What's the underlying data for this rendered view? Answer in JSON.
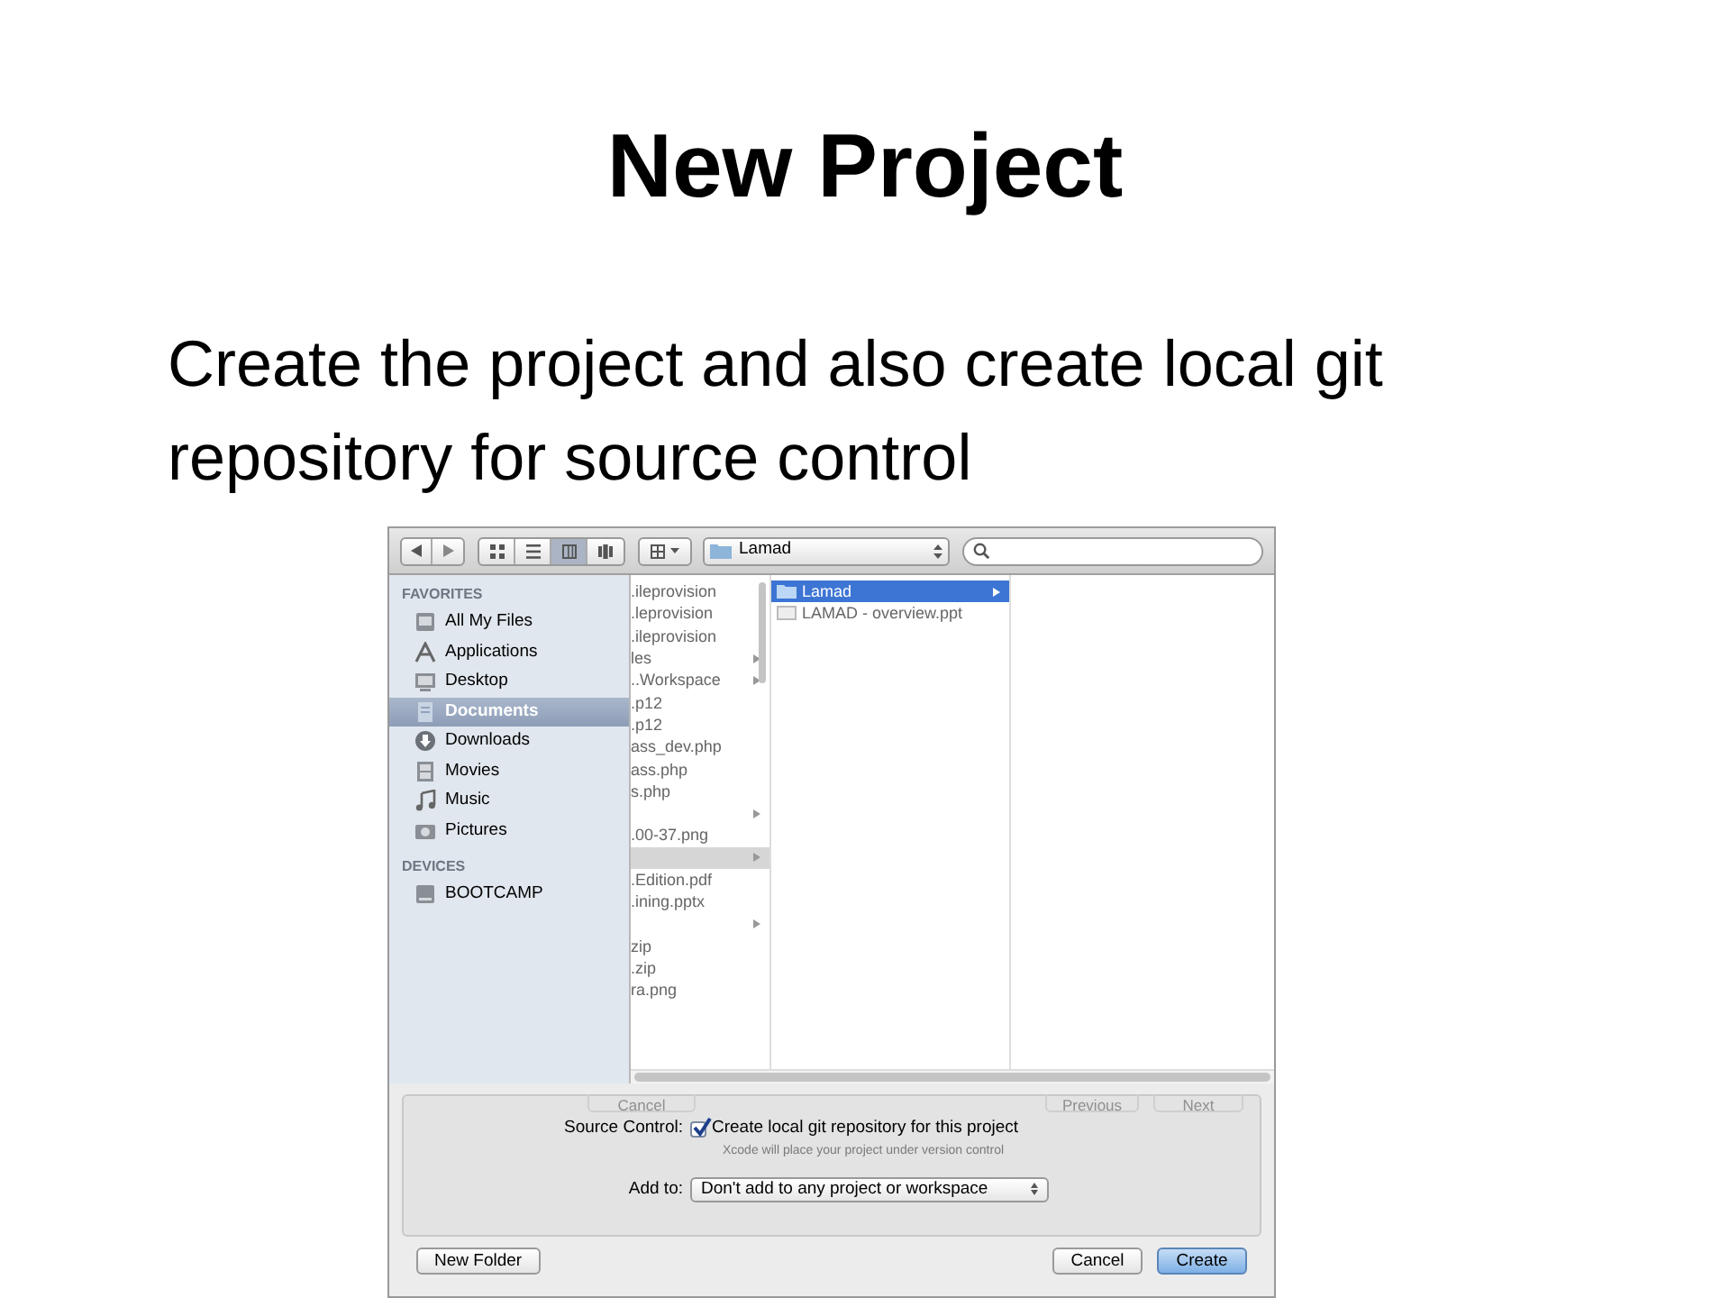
{
  "slide": {
    "title": "New Project",
    "body": "Create the project and also create local git repository for source control"
  },
  "dialog": {
    "toolbar": {
      "view_modes": [
        {
          "kind": "icons",
          "selected": false
        },
        {
          "kind": "list",
          "selected": false
        },
        {
          "kind": "columns",
          "selected": true
        },
        {
          "kind": "coverflow",
          "selected": false
        }
      ],
      "location": "Lamad"
    },
    "sidebar": [
      {
        "heading": "FAVORITES",
        "items": [
          {
            "label": "All My Files",
            "selected": false
          },
          {
            "label": "Applications",
            "selected": false
          },
          {
            "label": "Desktop",
            "selected": false
          },
          {
            "label": "Documents",
            "selected": true
          },
          {
            "label": "Downloads",
            "selected": false
          },
          {
            "label": "Movies",
            "selected": false
          },
          {
            "label": "Music",
            "selected": false
          },
          {
            "label": "Pictures",
            "selected": false
          }
        ]
      },
      {
        "heading": "DEVICES",
        "items": [
          {
            "label": "BOOTCAMP",
            "selected": false
          }
        ]
      }
    ],
    "columns": [
      {
        "focused": false,
        "items": [
          {
            "name": ".ileprovision",
            "arrow": false,
            "selected": false
          },
          {
            "name": ".leprovision",
            "arrow": false,
            "selected": false
          },
          {
            "name": ".ileprovision",
            "arrow": false,
            "selected": false
          },
          {
            "name": "les",
            "arrow": true,
            "selected": false
          },
          {
            "name": "..Workspace",
            "arrow": true,
            "selected": false
          },
          {
            "name": ".p12",
            "arrow": false,
            "selected": false
          },
          {
            "name": ".p12",
            "arrow": false,
            "selected": false
          },
          {
            "name": "ass_dev.php",
            "arrow": false,
            "selected": false
          },
          {
            "name": "ass.php",
            "arrow": false,
            "selected": false
          },
          {
            "name": "s.php",
            "arrow": false,
            "selected": false
          },
          {
            "arrow": true,
            "selected": false
          },
          {
            "name": ".00-37.png",
            "arrow": false,
            "selected": false
          },
          {
            "arrow": true,
            "selected": true
          },
          {
            "name": ".Edition.pdf",
            "arrow": false,
            "selected": false
          },
          {
            "name": ".ining.pptx",
            "arrow": false,
            "selected": false
          },
          {
            "arrow": true,
            "selected": false
          },
          {
            "name": "zip",
            "arrow": false,
            "selected": false
          },
          {
            "name": ".zip",
            "arrow": false,
            "selected": false
          },
          {
            "name": "ra.png",
            "arrow": false,
            "selected": false
          }
        ]
      },
      {
        "focused": true,
        "items": [
          {
            "kind": "folder",
            "name": "Lamad",
            "arrow": true,
            "selected": true
          },
          {
            "kind": "file",
            "name": "LAMAD - overview.ppt",
            "arrow": false,
            "selected": false
          }
        ]
      }
    ],
    "behind_buttons": [
      "Cancel",
      "Previous",
      "Next"
    ],
    "options": {
      "source_control": {
        "label": "Source Control:",
        "checkbox_label": "Create local git repository for this project",
        "checked": true,
        "hint": "Xcode will place your project under version control"
      },
      "add_to": {
        "label": "Add to:",
        "value": "Don't add to any project or workspace"
      }
    },
    "buttons": [
      {
        "label": "New Folder",
        "kind": "normal"
      },
      {
        "label": "Cancel",
        "kind": "normal"
      },
      {
        "label": "Create",
        "kind": "default"
      }
    ]
  }
}
